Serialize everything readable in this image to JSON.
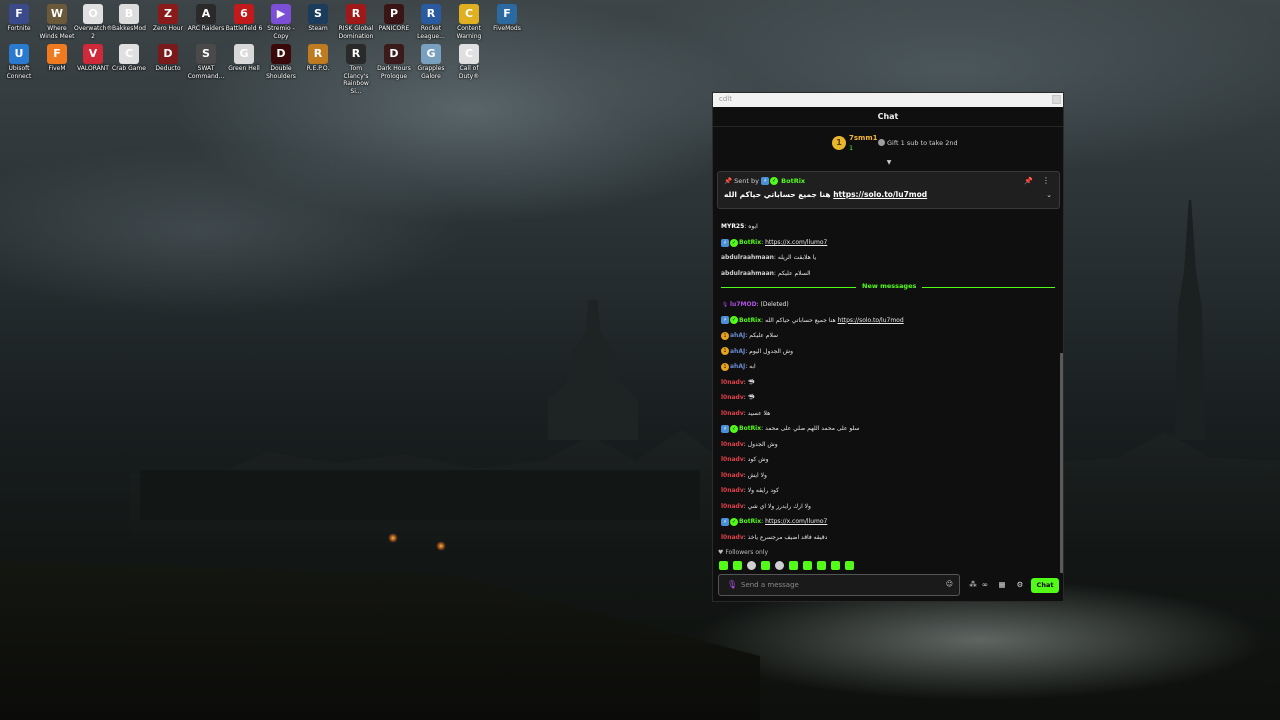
{
  "desktop_icons": [
    {
      "label": "Fortnite",
      "icon": "fortnite-icon",
      "color": "#3b4a8a",
      "glyph": "F"
    },
    {
      "label": "Where Winds Meet",
      "icon": "where-winds-meet-icon",
      "color": "#6b5a3a",
      "glyph": "W"
    },
    {
      "label": "Overwatch® 2",
      "icon": "overwatch-icon",
      "color": "#e0e0e0",
      "glyph": "O"
    },
    {
      "label": "BakkesMod",
      "icon": "bakkesmod-icon",
      "color": "#dddddd",
      "glyph": "B"
    },
    {
      "label": "Zero Hour",
      "icon": "zero-hour-icon",
      "color": "#8a1b1b",
      "glyph": "Z"
    },
    {
      "label": "ARC Raiders",
      "icon": "arc-raiders-icon",
      "color": "#2a2a2a",
      "glyph": "A"
    },
    {
      "label": "Battlefield 6",
      "icon": "battlefield-icon",
      "color": "#c21a1a",
      "glyph": "6"
    },
    {
      "label": "Stremio - Copy",
      "icon": "stremio-icon",
      "color": "#7b4fd6",
      "glyph": "▶"
    },
    {
      "label": "Steam",
      "icon": "steam-icon",
      "color": "#1b3c5c",
      "glyph": "S"
    },
    {
      "label": "RISK Global Domination",
      "icon": "risk-icon",
      "color": "#a01818",
      "glyph": "R"
    },
    {
      "label": "PANICORE",
      "icon": "panicore-icon",
      "color": "#3a1515",
      "glyph": "P"
    },
    {
      "label": "Rocket League...",
      "icon": "rocket-league-icon",
      "color": "#2a5aa0",
      "glyph": "R"
    },
    {
      "label": "Content Warning",
      "icon": "content-warning-icon",
      "color": "#e0b020",
      "glyph": "C"
    },
    {
      "label": "FiveMods",
      "icon": "fivemods-icon",
      "color": "#2a6aa0",
      "glyph": "F"
    },
    {
      "label": "Ubisoft Connect",
      "icon": "ubisoft-connect-icon",
      "color": "#2a7ad0",
      "glyph": "U"
    },
    {
      "label": "FiveM",
      "icon": "fivem-icon",
      "color": "#f07a20",
      "glyph": "F"
    },
    {
      "label": "VALORANT",
      "icon": "valorant-icon",
      "color": "#d02a3a",
      "glyph": "V"
    },
    {
      "label": "Crab Game",
      "icon": "crab-game-icon",
      "color": "#e0e0e0",
      "glyph": "C"
    },
    {
      "label": "Deducto",
      "icon": "deducto-icon",
      "color": "#7a1a1a",
      "glyph": "D"
    },
    {
      "label": "SWAT Command...",
      "icon": "swat-command-icon",
      "color": "#4a4a4a",
      "glyph": "S"
    },
    {
      "label": "Green Hell",
      "icon": "green-hell-icon",
      "color": "#d8d8d8",
      "glyph": "G"
    },
    {
      "label": "Double Shoulders",
      "icon": "double-shoulders-icon",
      "color": "#3a0a0a",
      "glyph": "D"
    },
    {
      "label": "R.E.P.O.",
      "icon": "repo-icon",
      "color": "#c07a20",
      "glyph": "R"
    },
    {
      "label": "Tom Clancy's Rainbow Si...",
      "icon": "rainbow-six-icon",
      "color": "#2a2a2a",
      "glyph": "R"
    },
    {
      "label": "Dark Hours Prologue",
      "icon": "dark-hours-icon",
      "color": "#3a1a1a",
      "glyph": "D"
    },
    {
      "label": "Grapples Galore",
      "icon": "grapples-galore-icon",
      "color": "#7aa0c0",
      "glyph": "G"
    },
    {
      "label": "Call of Duty®",
      "icon": "call-of-duty-icon",
      "color": "#e0e0e0",
      "glyph": "C"
    }
  ],
  "chat": {
    "window_title": "cdlt",
    "header_title": "Chat",
    "leaderboard": {
      "rank": "1",
      "name": "7smm1",
      "count": "1",
      "gift_text": "Gift 1 sub to take 2nd"
    },
    "pinned": {
      "sent_by_label": "Sent by",
      "sender": "BotRix",
      "message": "هنا جميع حساباتي حياكم الله",
      "link": "https://solo.to/lu7mod"
    },
    "messages_before": [
      {
        "user": "MYR25",
        "user_color": "#ffffff",
        "text": "ابوه",
        "link": "",
        "badges": []
      },
      {
        "user": "BotRix",
        "user_color": "#53fc18",
        "text": "",
        "link": "https://x.com/llumo7",
        "badges": [
          "bot",
          "verified"
        ]
      },
      {
        "user": "abdulraahmaan",
        "user_color": "#d0d0d0",
        "text": "يا هلابقت الريله",
        "link": "",
        "badges": []
      },
      {
        "user": "abdulraahmaan",
        "user_color": "#d0d0d0",
        "text": "السلام عليكم",
        "link": "",
        "badges": []
      }
    ],
    "new_messages_label": "New messages",
    "messages_after": [
      {
        "user": "lu7MOD",
        "user_color": "#b04fe8",
        "text": "(Deleted)",
        "link": "",
        "badges": [
          "mic"
        ]
      },
      {
        "user": "BotRix",
        "user_color": "#53fc18",
        "text": "هنا جميع حساباتي حياكم الله",
        "link": "https://solo.to/lu7mod",
        "badges": [
          "bot",
          "verified"
        ]
      },
      {
        "user": "ahAJ",
        "user_color": "#6a8ad0",
        "text": "سلام عليكم",
        "link": "",
        "badges": [
          "sub"
        ]
      },
      {
        "user": "ahAJ",
        "user_color": "#6a8ad0",
        "text": "وش الجدول اليوم",
        "link": "",
        "badges": [
          "sub"
        ]
      },
      {
        "user": "ahAJ",
        "user_color": "#6a8ad0",
        "text": "ابه",
        "link": "",
        "badges": [
          "sub"
        ]
      },
      {
        "user": "l0nadv",
        "user_color": "#e0404a",
        "text": "🦈",
        "link": "",
        "badges": []
      },
      {
        "user": "l0nadv",
        "user_color": "#e0404a",
        "text": "🦈",
        "link": "",
        "badges": []
      },
      {
        "user": "l0nadv",
        "user_color": "#e0404a",
        "text": "هلا عسيد",
        "link": "",
        "badges": []
      },
      {
        "user": "BotRix",
        "user_color": "#53fc18",
        "text": "سلو على محمد اللهم صلي على محمد",
        "link": "",
        "badges": [
          "bot",
          "verified"
        ]
      },
      {
        "user": "l0nadv",
        "user_color": "#e0404a",
        "text": "وش الجدول",
        "link": "",
        "badges": []
      },
      {
        "user": "l0nadv",
        "user_color": "#e0404a",
        "text": "وش كود",
        "link": "",
        "badges": []
      },
      {
        "user": "l0nadv",
        "user_color": "#e0404a",
        "text": "ولا ايش",
        "link": "",
        "badges": []
      },
      {
        "user": "l0nadv",
        "user_color": "#e0404a",
        "text": "كود رايقه ولا",
        "link": "",
        "badges": []
      },
      {
        "user": "l0nadv",
        "user_color": "#e0404a",
        "text": "ولا ارك رايدرز ولا اي شي",
        "link": "",
        "badges": []
      },
      {
        "user": "BotRix",
        "user_color": "#53fc18",
        "text": "",
        "link": "https://x.com/llumo7",
        "badges": [
          "bot",
          "verified"
        ]
      },
      {
        "user": "l0nadv",
        "user_color": "#e0404a",
        "text": "دقيقه فاقد اضيف مرجسرع ياخذ",
        "link": "",
        "badges": []
      }
    ],
    "followers_only_label": "Followers only",
    "input_placeholder": "Send a message",
    "send_button_label": "Chat",
    "accent_color": "#53fc18"
  }
}
